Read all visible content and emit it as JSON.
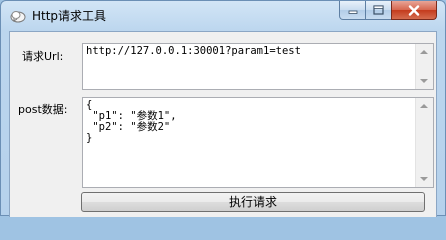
{
  "window": {
    "title": "Http请求工具",
    "controls": {
      "minimize": "minimize-icon",
      "maximize": "maximize-icon",
      "close": "close-icon"
    }
  },
  "form": {
    "url_label": "请求Url:",
    "url_value": "http://127.0.0.1:30001?param1=test",
    "post_label": "post数据:",
    "post_value": "{\n \"p1\": \"参数1\",\n \"p2\": \"参数2\"\n}",
    "submit_label": "执行请求"
  },
  "colors": {
    "title_bar": "#bcd6ee",
    "close_button": "#c43b1d",
    "client_bg": "#f0f0f0"
  }
}
